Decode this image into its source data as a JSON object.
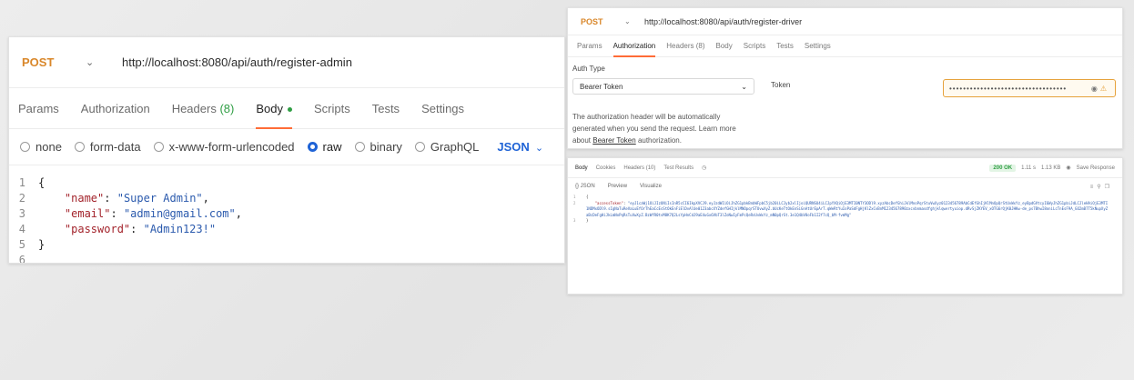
{
  "panel1": {
    "method": "POST",
    "url": "http://localhost:8080/api/auth/register-admin",
    "tabs": [
      {
        "label": "Params"
      },
      {
        "label": "Authorization"
      },
      {
        "label": "Headers",
        "count": "(8)"
      },
      {
        "label": "Body"
      },
      {
        "label": "Scripts"
      },
      {
        "label": "Tests"
      },
      {
        "label": "Settings"
      }
    ],
    "body_types": [
      "none",
      "form-data",
      "x-www-form-urlencoded",
      "raw",
      "binary",
      "GraphQL"
    ],
    "selected_body_type": "raw",
    "format": "JSON",
    "code_lines": [
      {
        "n": "1",
        "text": "{"
      },
      {
        "n": "2",
        "key": "\"name\"",
        "value": "\"Super Admin\"",
        "tail": ","
      },
      {
        "n": "3",
        "key": "\"email\"",
        "value": "\"admin@gmail.com\"",
        "tail": ","
      },
      {
        "n": "4",
        "key": "\"password\"",
        "value": "\"Admin123!\"",
        "tail": ""
      },
      {
        "n": "5",
        "text": "}"
      },
      {
        "n": "6",
        "text": ""
      }
    ]
  },
  "panel2": {
    "method": "POST",
    "url": "http://localhost:8080/api/auth/register-driver",
    "tabs": [
      "Params",
      "Authorization",
      "Headers (8)",
      "Body",
      "Scripts",
      "Tests",
      "Settings"
    ],
    "auth_type_label": "Auth Type",
    "auth_type_value": "Bearer Token",
    "description_line1": "The authorization header will be automatically",
    "description_line2": "generated when you send the request. Learn more",
    "description_line3_pre": "about",
    "description_link": "Bearer Token",
    "description_line3_post": "authorization.",
    "token_label": "Token",
    "token_value": "••••••••••••••••••••••••••••••••••"
  },
  "panel3": {
    "tabs": [
      "Body",
      "Cookies",
      "Headers (10)",
      "Test Results"
    ],
    "status": "200 OK",
    "time": "1.11 s",
    "size": "1.13 KB",
    "save_label": "Save Response",
    "format": "{} JSON",
    "preview_label": "Preview",
    "visualize_label": "Visualize",
    "lines": [
      {
        "n": "1",
        "text": "{"
      },
      {
        "n": "2",
        "key": "\"accessToken\"",
        "value": "\"eyJ1caWj1OiJIzUNiIsInR5cCI6IkpXVCJ9.eyJzdWIiOiJhZG1pbkBnbWFpbC5jb20iLCJyb2xlIjoiQURNSU4iLCJpYXQiOjE3MTI0NTY3ODl9.xyzAbcDefGhiJklMnoPqrStuVwXyz0123456789AbCdEfGhIjKlMnOpQrStUvWxYz_eyBpdGVtcyI6WyJhZG1pbiJdLCJleHAiOjE3MTI1NDMxODl9.sIgNaTuReVaLuEfOrThEaCcEsStOkEnFiElDvAlUe0123abcXYZdefGHIjklMNOpqrSTUvwXyZ.bUcKeTtOkEnSiGnAtUrEpArT.qWeRtYuIoPaSdFgHjKlZxCvBnM1234567890zxcvbnmasdfghjklqwertyuiop.dRvSjZKYEV_xOTG6rQjK0JHKw-de_ps7BhwI8oniLcTnEsF9A_GO2mB7T5kNupXyZaBcDeFgHiJkLmNoPqRsTuVwXyZ.BzWfR0tvM8K7Q2LsYpHnCdJ9aE4uGx6VbT3lZoNwIyFmPcQeRsUvWxYz_mN0pQrSt.3e1Q4bV8oFb1I2f7cQ_bM-fvmMg\""
      },
      {
        "n": "3",
        "text": "}"
      }
    ]
  }
}
